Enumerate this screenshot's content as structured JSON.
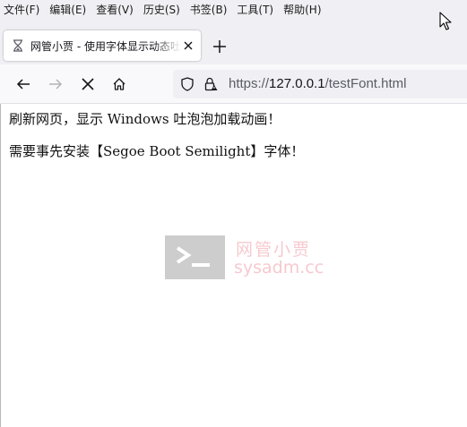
{
  "menubar": {
    "items": [
      {
        "label": "文件(F)"
      },
      {
        "label": "编辑(E)"
      },
      {
        "label": "查看(V)"
      },
      {
        "label": "历史(S)"
      },
      {
        "label": "书签(B)"
      },
      {
        "label": "工具(T)"
      },
      {
        "label": "帮助(H)"
      }
    ]
  },
  "tab": {
    "title": "网管小贾 - 使用字体显示动态吐泡泡加载动画",
    "icon": "hourglass-icon"
  },
  "nav": {
    "back_icon": "back-arrow-icon",
    "forward_icon": "forward-arrow-icon",
    "stop_icon": "stop-icon",
    "home_icon": "home-icon",
    "url_prefix": "https://",
    "url_host": "127.0.0.1",
    "url_path": "/testFont.html"
  },
  "content": {
    "line1": "刷新网页，显示 Windows 吐泡泡加载动画！",
    "line2": "需要事先安装【Segoe Boot Semilight】字体！"
  },
  "watermark": {
    "name": "网管小贾",
    "domain": "sysadm.cc",
    "color": "#f3b7bf"
  }
}
